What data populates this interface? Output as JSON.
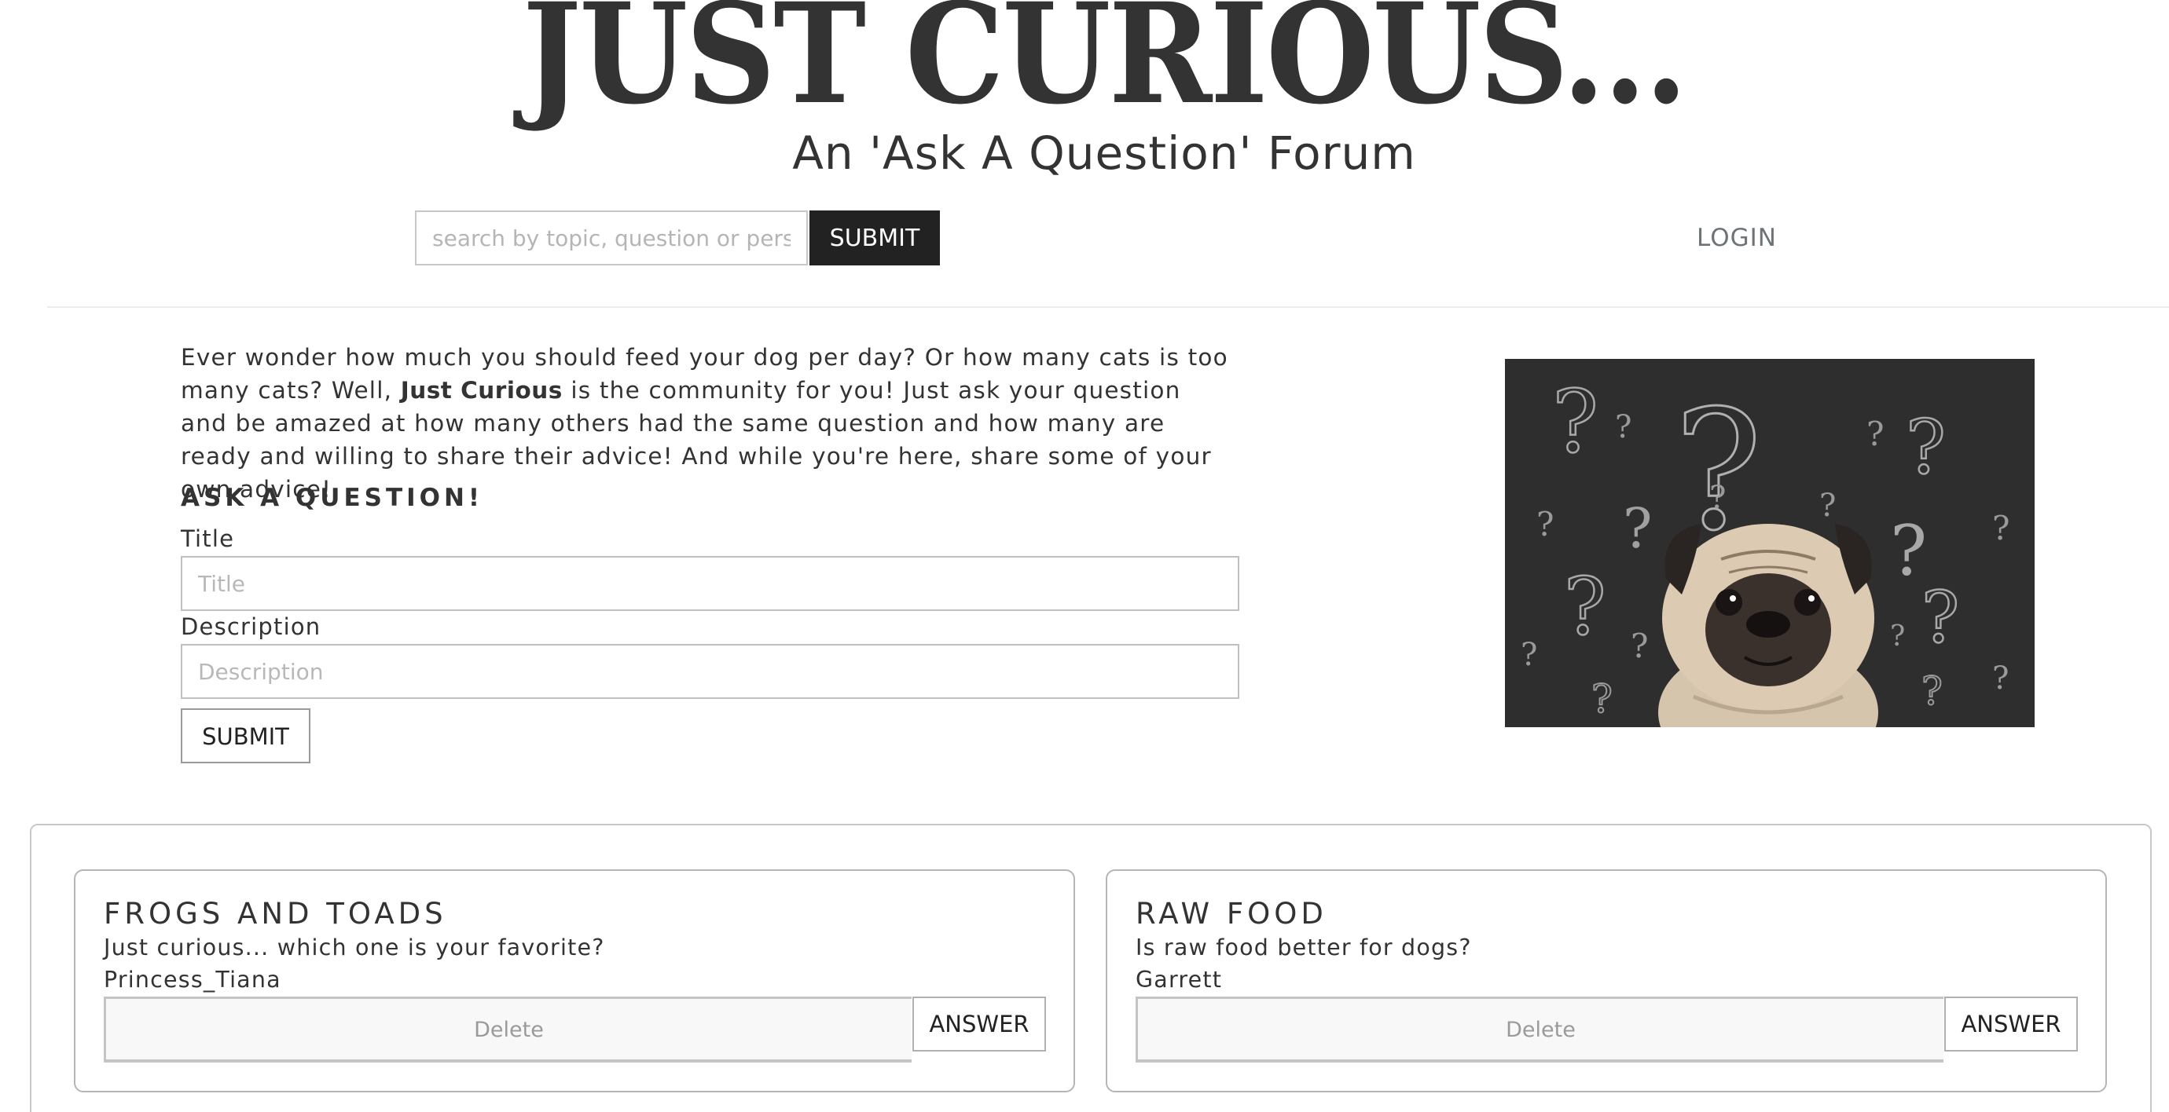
{
  "header": {
    "title": "JUST CURIOUS...",
    "subtitle": "An 'Ask A Question' Forum"
  },
  "search": {
    "placeholder": "search by topic, question or person",
    "value": "",
    "submit_label": "SUBMIT"
  },
  "nav": {
    "login_label": "LOGIN"
  },
  "intro": {
    "text_before": "Ever wonder how much you should feed your dog per day? Or how many cats is too many cats? Well, ",
    "brand": "Just Curious",
    "text_after": " is the community for you! Just ask your question and be amazed at how many others had the same question and how many are ready and willing to share their advice! And while you're here, share some of your own advice!"
  },
  "ask_form": {
    "heading": "ASK A QUESTION!",
    "title_label": "Title",
    "title_placeholder": "Title",
    "description_label": "Description",
    "description_placeholder": "Description",
    "submit_label": "SUBMIT"
  },
  "hero_image": {
    "description": "pug-with-question-marks"
  },
  "questions": [
    {
      "title": "FROGS AND TOADS",
      "description": "Just curious... which one is your favorite?",
      "author": "Princess_Tiana",
      "delete_label": "Delete",
      "answer_label": "ANSWER"
    },
    {
      "title": "RAW FOOD",
      "description": "Is raw food better for dogs?",
      "author": "Garrett",
      "delete_label": "Delete",
      "answer_label": "ANSWER"
    }
  ],
  "colors": {
    "text": "#333333",
    "search_button_bg": "#222222",
    "login_text": "#6e7378",
    "hero_bg": "#2e2e2e",
    "border": "#c8c8c8"
  }
}
